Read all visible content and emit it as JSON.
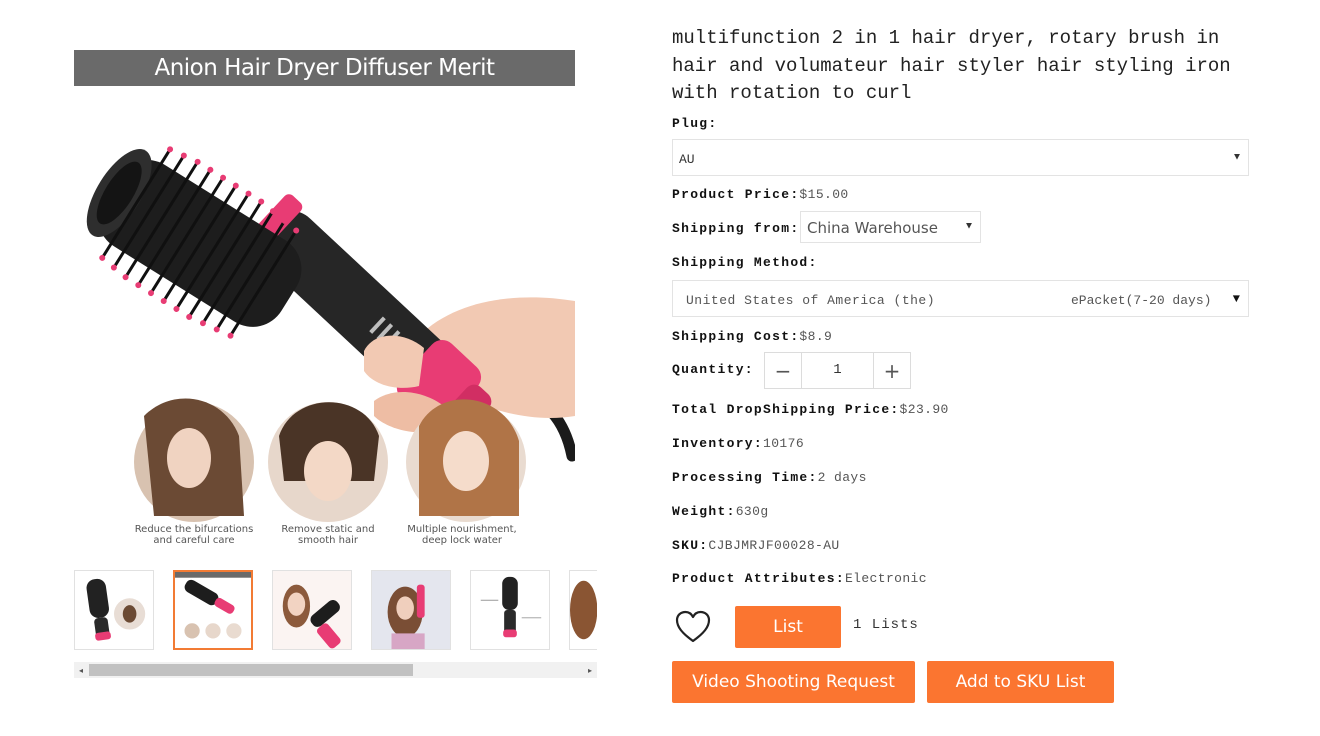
{
  "gallery": {
    "banner": "Anion Hair Dryer Diffuser Merit",
    "captions": [
      {
        "line1": "Reduce the bifurcations",
        "line2": "and careful care"
      },
      {
        "line1": "Remove static and",
        "line2": "smooth hair"
      },
      {
        "line1": "Multiple nourishment,",
        "line2": "deep lock water"
      }
    ],
    "thumb_banner": "Anion Hair Dryer Diffuser Merit",
    "scroll_left": "◂",
    "scroll_right": "▸"
  },
  "product": {
    "title": "multifunction 2 in 1 hair dryer, rotary brush in hair and volumateur hair styler hair styling iron with rotation to curl",
    "plug_label": "Plug:",
    "plug_value": "AU",
    "price_label": "Product Price:",
    "price_value": "$15.00",
    "ship_from_label": "Shipping from:",
    "ship_from_value": "China Warehouse",
    "ship_method_label": "Shipping Method:",
    "ship_method_country": "United States of America (the)",
    "ship_method_service": "ePacket(7-20 days)",
    "ship_cost_label": "Shipping Cost:",
    "ship_cost_value": "$8.9",
    "quantity_label": "Quantity:",
    "quantity_value": "1",
    "minus": "−",
    "plus": "+",
    "total_label": "Total DropShipping Price:",
    "total_value": "$23.90",
    "inventory_label": "Inventory:",
    "inventory_value": "10176",
    "processing_label": "Processing Time:",
    "processing_value": "2 days",
    "weight_label": "Weight:",
    "weight_value": "630g",
    "sku_label": "SKU:",
    "sku_value": "CJBJMRJF00028-AU",
    "attributes_label": "Product Attributes:",
    "attributes_value": "Electronic"
  },
  "actions": {
    "list_label": "List",
    "lists_count": "1 Lists",
    "video_label": "Video Shooting Request",
    "sku_list_label": "Add to SKU List"
  },
  "colors": {
    "accent": "#fb7530",
    "brush_pink": "#e83c74",
    "banner_gray": "#6a6a6a"
  }
}
